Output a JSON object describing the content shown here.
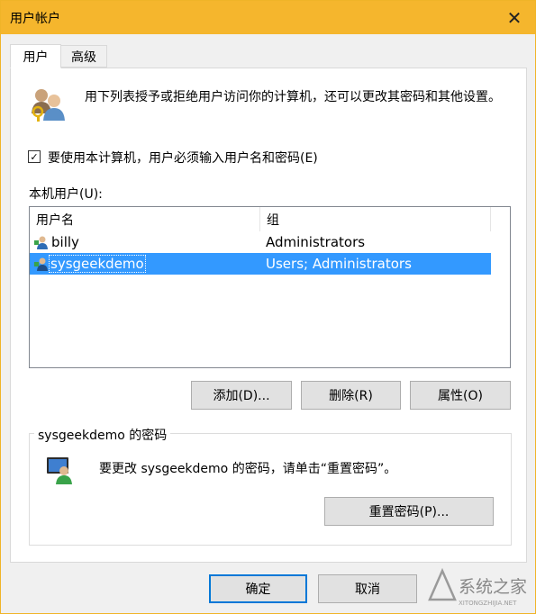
{
  "window": {
    "title": "用户帐户",
    "close_glyph": "✕"
  },
  "tabs": [
    {
      "label": "用户",
      "active": true
    },
    {
      "label": "高级",
      "active": false
    }
  ],
  "intro": {
    "text": "用下列表授予或拒绝用户访问你的计算机，还可以更改其密码和其他设置。"
  },
  "require_login": {
    "checked": true,
    "label": "要使用本计算机，用户必须输入用户名和密码(E)"
  },
  "local_users_label": "本机用户(U):",
  "user_list": {
    "columns": [
      "用户名",
      "组"
    ],
    "rows": [
      {
        "name": "billy",
        "group": "Administrators",
        "selected": false
      },
      {
        "name": "sysgeekdemo",
        "group": "Users; Administrators",
        "selected": true
      }
    ]
  },
  "list_buttons": {
    "add": "添加(D)...",
    "remove": "删除(R)",
    "properties": "属性(O)"
  },
  "password_group": {
    "title": "sysgeekdemo 的密码",
    "text": "要更改 sysgeekdemo 的密码，请单击“重置密码”。",
    "reset_button": "重置密码(P)..."
  },
  "footer": {
    "ok": "确定",
    "cancel": "取消"
  },
  "watermark": {
    "text": "系统之家",
    "subtext": "XITONGZHIJIA.NET"
  },
  "colors": {
    "titlebar": "#f5b62d",
    "selection": "#3399ff",
    "ok_border": "#0078d7"
  },
  "icons": {
    "users": "users-icon",
    "user": "user-icon",
    "password": "user-password-icon",
    "close": "close-icon",
    "checkmark": "checkmark-icon"
  }
}
